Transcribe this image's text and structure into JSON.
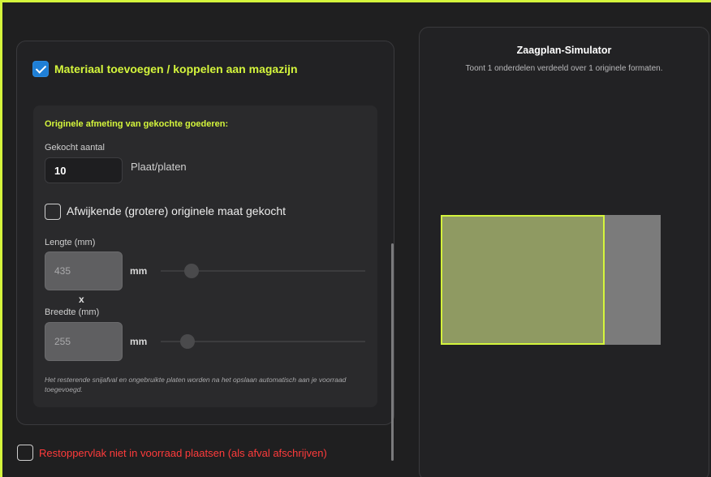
{
  "material_form": {
    "link_checkbox": {
      "label": "Materiaal toevoegen / koppelen aan magazijn",
      "checked": true
    },
    "original_size_section": {
      "title": "Originele afmeting van gekochte goederen:",
      "quantity": {
        "label": "Gekocht aantal",
        "value": "10",
        "unit": "Plaat/platen"
      },
      "deviating_checkbox": {
        "label": "Afwijkende (grotere) originele maat gekocht",
        "checked": false
      },
      "length": {
        "label": "Lengte (mm)",
        "value": "435",
        "unit": "mm"
      },
      "separator": "x",
      "width": {
        "label": "Breedte (mm)",
        "value": "255",
        "unit": "mm"
      },
      "note": "Het resterende snijafval en ongebruikte platen worden na het opslaan automatisch aan je voorraad toegevoegd."
    },
    "rest_checkbox": {
      "label": "Restoppervlak niet in voorraad plaatsen (als afval afschrijven)",
      "checked": false
    }
  },
  "simulator": {
    "title": "Zaagplan-Simulator",
    "subtitle": "Toont 1 onderdelen verdeeld over 1 originele formaten."
  },
  "colors": {
    "accent": "#d4f53c",
    "checkbox_blue": "#1f7fd6",
    "warning_red": "#ff3b3b",
    "part_fill": "#8f9a62",
    "board_fill": "#7b7b7b"
  }
}
